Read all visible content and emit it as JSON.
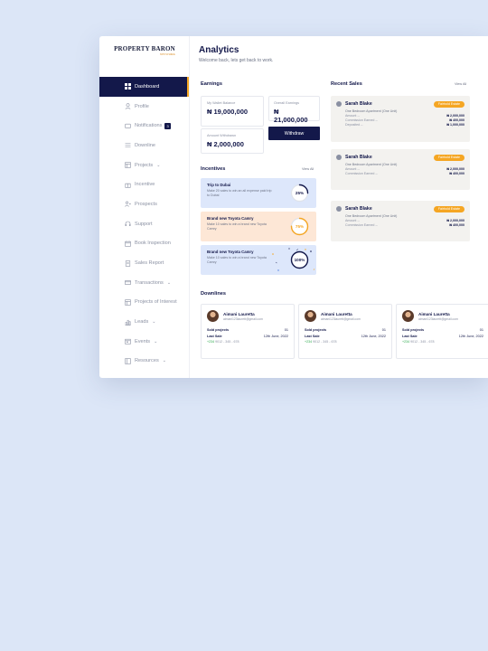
{
  "brand": {
    "name": "PROPERTY BARON",
    "sub": "NETWORK"
  },
  "page": {
    "title": "Analytics",
    "subtitle": "Welcome back, lets get back to work."
  },
  "sidebar": {
    "items": [
      {
        "label": "Dashboard",
        "icon": "grid-icon"
      },
      {
        "label": "Profile",
        "icon": "user-icon"
      },
      {
        "label": "Notifications",
        "icon": "bell-icon",
        "badge": "3"
      },
      {
        "label": "Downline",
        "icon": "list-icon"
      },
      {
        "label": "Projects",
        "icon": "folder-icon",
        "caret": "⌄"
      },
      {
        "label": "Incentive",
        "icon": "gift-icon"
      },
      {
        "label": "Prospects",
        "icon": "users-icon"
      },
      {
        "label": "Support",
        "icon": "headset-icon"
      },
      {
        "label": "Book Inspection",
        "icon": "calendar-icon"
      },
      {
        "label": "Sales Report",
        "icon": "document-icon"
      },
      {
        "label": "Transactions",
        "icon": "card-icon",
        "caret": "⌄"
      },
      {
        "label": "Projects of Interest",
        "icon": "bookmark-icon"
      },
      {
        "label": "Leads",
        "icon": "chart-icon",
        "caret": "⌄"
      },
      {
        "label": "Events",
        "icon": "event-icon",
        "caret": "⌄"
      },
      {
        "label": "Resources",
        "icon": "resource-icon",
        "caret": "⌄"
      }
    ]
  },
  "earnings": {
    "title": "Earnings",
    "wallet_label": "My Wallet Balance",
    "wallet_value": "₦ 19,000,000",
    "overall_label": "Overall Earnings",
    "overall_value": "₦ 21,000,000",
    "withdrawn_label": "Amount Withdrawn",
    "withdrawn_value": "₦ 2,000,000",
    "withdraw_button": "Withdraw"
  },
  "incentives": {
    "title": "Incentives",
    "view_all": "View All",
    "items": [
      {
        "title": "Trip to Dubai",
        "desc": "Make 20 sales to win an all expense paid trip to Dubai",
        "percent_text": "25%",
        "percent": 25,
        "bg": "#dde7fb",
        "ring": "#13184a"
      },
      {
        "title": "Brand new Toyota Camry",
        "desc": "Make 10 sales to win a brand new Toyota Camry",
        "percent_text": "75%",
        "percent": 75,
        "bg": "#fde7d6",
        "ring": "#f5a623"
      },
      {
        "title": "Brand new Toyota Camry",
        "desc": "Make 10 sales to win a brand new Toyota Camry",
        "percent_text": "100%",
        "percent": 100,
        "bg": "#dde7fb",
        "ring": "#13184a"
      }
    ]
  },
  "recent_sales": {
    "title": "Recent Sales",
    "view_all": "View All",
    "items": [
      {
        "name": "Sarah Blake",
        "tag": "Fairhold Estate",
        "property": "One Bedroom Apartment (One Unit)",
        "rows": [
          {
            "k": "Amount --",
            "v": "₦ 2,000,000"
          },
          {
            "k": "Commission Earned --",
            "v": "₦ 400,000"
          },
          {
            "k": "Deposited --",
            "v": "₦ 1,000,000"
          }
        ]
      },
      {
        "name": "Sarah Blake",
        "tag": "Fairhold Estate",
        "property": "One Bedroom Apartment (One Unit)",
        "rows": [
          {
            "k": "Amount --",
            "v": "₦ 2,000,000"
          },
          {
            "k": "Commission Earned --",
            "v": "₦ 400,000"
          }
        ]
      },
      {
        "name": "Sarah Blake",
        "tag": "Fairhold Estate",
        "property": "One Bedroom Apartment (One Unit)",
        "rows": [
          {
            "k": "Amount --",
            "v": "₦ 2,000,000"
          },
          {
            "k": "Commission Earned --",
            "v": "₦ 400,000"
          }
        ]
      }
    ]
  },
  "downlines": {
    "title": "Downlines",
    "items": [
      {
        "name": "Aimani Lauretta",
        "email": "aimani123laurett@gmail.com",
        "sold_label": "Sold projects",
        "sold": "01",
        "last_label": "Last Sale",
        "last": "12th June, 2022",
        "cc": "+234",
        "phone": "9012 - 345 - 678"
      },
      {
        "name": "Aimani Lauretta",
        "email": "aimani123laurett@gmail.com",
        "sold_label": "Sold projects",
        "sold": "01",
        "last_label": "Last Sale",
        "last": "12th June, 2022",
        "cc": "+234",
        "phone": "9012 - 345 - 678"
      },
      {
        "name": "Aimani Lauretta",
        "email": "aimani123laurett@gmail.com",
        "sold_label": "Sold projects",
        "sold": "01",
        "last_label": "Last Sale",
        "last": "12th June, 2022",
        "cc": "+234",
        "phone": "9012 - 345 - 678"
      }
    ]
  }
}
